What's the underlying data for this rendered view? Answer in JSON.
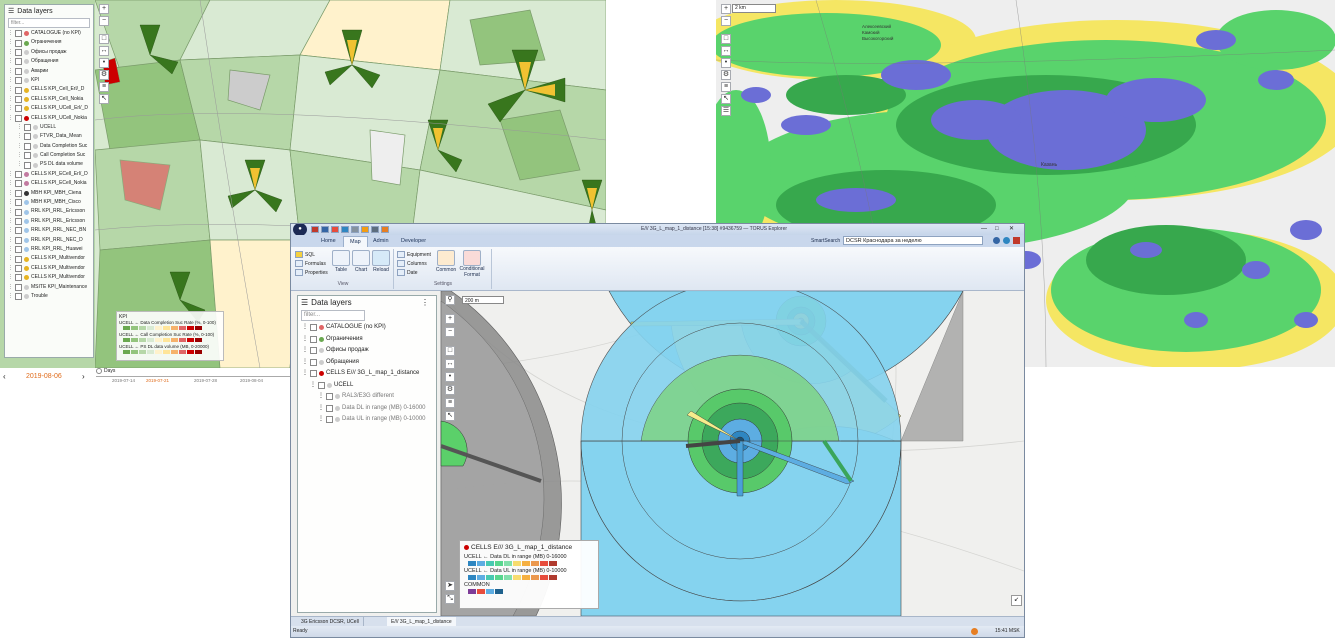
{
  "panel1": {
    "layers_title": "Data layers",
    "filter_placeholder": "filter...",
    "layers": [
      {
        "label": "CATALOGUE (no KPI)",
        "color": "#e06666"
      },
      {
        "label": "Ограничения",
        "color": "#6aa84f"
      },
      {
        "label": "Офисы продаж",
        "color": "#cccccc"
      },
      {
        "label": "Обращения",
        "color": "#cccccc"
      },
      {
        "label": "Аварии",
        "color": "#cccccc"
      },
      {
        "label": "KPI",
        "color": "#cccccc"
      },
      {
        "label": "CELLS KPI_Cell_Erl/_D",
        "color": "#e6b422"
      },
      {
        "label": "CELLS KPI_Cell_Nokia",
        "color": "#e6b422"
      },
      {
        "label": "CELLS KPI_UCell_Erl/_D",
        "color": "#e6b422"
      },
      {
        "label": "CELLS KPI_UCell_Nokia",
        "color": "#cc0000"
      },
      {
        "label": "UCELL",
        "color": "#cccccc"
      },
      {
        "label": "FTVR_Data_Mean",
        "color": "#cccccc"
      },
      {
        "label": "Data Completion Suc",
        "color": "#cccccc"
      },
      {
        "label": "Call Completion Suc",
        "color": "#cccccc"
      },
      {
        "label": "PS DL data volume",
        "color": "#cccccc"
      },
      {
        "label": "CELLS KPI_ECell_Erl/_D",
        "color": "#c27ba0"
      },
      {
        "label": "CELLS KPI_ECell_Nokia",
        "color": "#c27ba0"
      },
      {
        "label": "MBH KPI_MBH_Ciena",
        "color": "#333333"
      },
      {
        "label": "MBH KPI_MBH_Cisco",
        "color": "#9fc5e8"
      },
      {
        "label": "RRL KPI_RRL_Ericsson",
        "color": "#9fc5e8"
      },
      {
        "label": "RRL KPI_RRL_Ericsson",
        "color": "#9fc5e8"
      },
      {
        "label": "RRL KPI_RRL_NEC_BN",
        "color": "#9fc5e8"
      },
      {
        "label": "RRL KPI_RRL_NEC_D",
        "color": "#9fc5e8"
      },
      {
        "label": "RRL KPI_RRL_Huawei",
        "color": "#9fc5e8"
      },
      {
        "label": "CELLS KPI_Multivendor",
        "color": "#e6b422"
      },
      {
        "label": "CELLS KPI_Multivendor",
        "color": "#e6b422"
      },
      {
        "label": "CELLS KPI_Multivendor",
        "color": "#e6b422"
      },
      {
        "label": "MSITE KPI_Maintenance",
        "color": "#cccccc"
      },
      {
        "label": "Trouble",
        "color": "#cccccc"
      }
    ],
    "legend": {
      "title": "KPI",
      "rows": [
        "UCELL ← Data Completion Suc Rate (%, 0-100)",
        "UCELL ← Call Completion Suc Rate (%, 0-100)",
        "UCELL ← PS DL data volume (MB, 0-20000)"
      ],
      "colors": [
        "#6aa84f",
        "#93c47d",
        "#b6d7a8",
        "#d9ead3",
        "#fff2cc",
        "#ffe599",
        "#f6b26b",
        "#e06666",
        "#cc0000",
        "#990000"
      ]
    },
    "timeline": {
      "date": "2019-08-06",
      "unit": "Days",
      "ticks": [
        "2019-07-14",
        "2019-07-21",
        "2019-07-28",
        "2019-08-04"
      ]
    }
  },
  "panel2": {
    "scale": "2 km",
    "city_label": "Казань",
    "area_label": "Алексеевский Камский Высокогорский"
  },
  "app": {
    "title": "E/// 3G_L_map_1_distance [15:38] #9436759 — TORUS Explorer",
    "tabs": [
      "Home",
      "Map",
      "Admin",
      "Developer"
    ],
    "active_tab": "Map",
    "smart_search_label": "SmartSearch",
    "search_value": "DCSR Краснодара за неделю",
    "ribbon": {
      "view": {
        "sql": "SQL",
        "formulas": "Formulas",
        "properties": "Properties",
        "table": "Table",
        "chart": "Chart",
        "reload": "Reload",
        "caption": "View"
      },
      "settings": {
        "equipment": "Equipment",
        "columns": "Columns",
        "date": "Date",
        "common": "Common",
        "conditional": "Conditional",
        "format": "Format",
        "caption": "Settings"
      }
    },
    "layers": {
      "title": "Data layers",
      "filter_placeholder": "filter...",
      "rows": [
        {
          "label": "CATALOGUE (no KPI)",
          "color": "#e06666"
        },
        {
          "label": "Ограничения",
          "color": "#6aa84f"
        },
        {
          "label": "Офисы продаж",
          "color": "#cccccc"
        },
        {
          "label": "Обращения",
          "color": "#cccccc"
        },
        {
          "label": "CELLS E/// 3G_L_map_1_distance",
          "color": "#cc0000"
        },
        {
          "label": "UCELL",
          "color": "#cccccc"
        },
        {
          "label": "RAL3/E3G different",
          "color": "#cccccc"
        },
        {
          "label": "Data DL in range (MB) 0-16000",
          "color": "#cccccc"
        },
        {
          "label": "Data UL in range (MB) 0-10000",
          "color": "#cccccc"
        }
      ]
    },
    "legend": {
      "title": "CELLS E/// 3G_L_map_1_distance",
      "row1": "UCELL ← Data DL in range (MB) 0-16000",
      "row2": "UCELL ← Data UL in range (MB) 0-10000",
      "common": "COMMON",
      "colors": [
        "#2e86c1",
        "#5dade2",
        "#48c9b0",
        "#58d68d",
        "#82e0aa",
        "#f7dc6f",
        "#f5b041",
        "#eb984e",
        "#e74c3c",
        "#b03a2e"
      ],
      "common_colors": [
        "#7d3c98",
        "#e74c3c",
        "#5dade2",
        "#1f618d"
      ]
    },
    "doc_tabs": [
      "3G Ericsson DCSR, UCell",
      "E/// 3G_L_map_1_distance"
    ],
    "status": {
      "ready": "Ready",
      "time": "15:41 MSK"
    },
    "scale": "200 m"
  }
}
